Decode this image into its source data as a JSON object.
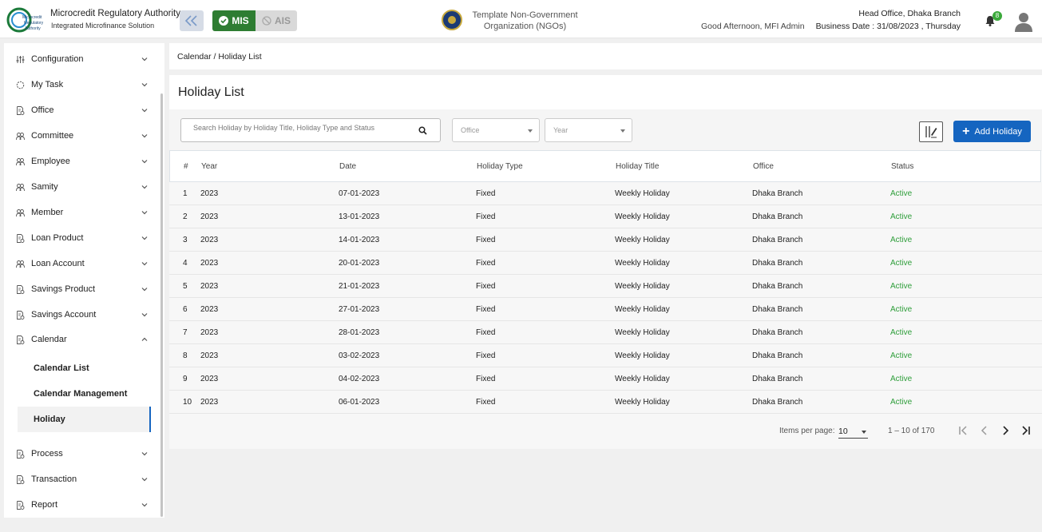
{
  "header": {
    "brand_title": "Microcredit Regulatory Authority",
    "brand_subtitle": "Integrated Microfinance Solution",
    "logo_text": "Microcredit Regulatory Authority",
    "mode_mis": "MIS",
    "mode_ais": "AIS",
    "org_name": "Template Non-Government Organization (NGOs)",
    "greeting": "Good Afternoon, MFI Admin",
    "head_office": "Head Office, Dhaka Branch",
    "business_date": "Business Date : 31/08/2023 , Thursday",
    "notification_count": "8",
    "colors": {
      "mis_active": "#2e7d32",
      "primary": "#1565c0",
      "status_active": "#2e9e3a"
    }
  },
  "sidebar": {
    "items": [
      {
        "label": "Configuration",
        "icon": "sliders-icon"
      },
      {
        "label": "My Task",
        "icon": "task-circle-icon"
      },
      {
        "label": "Office",
        "icon": "document-gear-icon"
      },
      {
        "label": "Committee",
        "icon": "committee-icon"
      },
      {
        "label": "Employee",
        "icon": "employee-icon"
      },
      {
        "label": "Samity",
        "icon": "samity-icon"
      },
      {
        "label": "Member",
        "icon": "member-icon"
      },
      {
        "label": "Loan Product",
        "icon": "document-gear-icon"
      },
      {
        "label": "Loan Account",
        "icon": "member-icon"
      },
      {
        "label": "Savings Product",
        "icon": "document-gear-icon"
      },
      {
        "label": "Savings Account",
        "icon": "document-gear-icon"
      },
      {
        "label": "Calendar",
        "icon": "document-gear-icon"
      },
      {
        "label": "Process",
        "icon": "document-gear-icon"
      },
      {
        "label": "Transaction",
        "icon": "document-gear-icon"
      },
      {
        "label": "Report",
        "icon": "document-gear-icon"
      }
    ],
    "calendar_sub": [
      {
        "label": "Calendar List"
      },
      {
        "label": "Calendar Management"
      },
      {
        "label": "Holiday"
      }
    ]
  },
  "breadcrumb": "Calendar / Holiday List",
  "page_title": "Holiday List",
  "toolbar": {
    "search_placeholder": "Search Holiday by Holiday Title, Holiday Type and Status",
    "office_placeholder": "Office",
    "year_placeholder": "Year",
    "add_label": "Add Holiday"
  },
  "table": {
    "columns": [
      "#",
      "Year",
      "Date",
      "Holiday Type",
      "Holiday Title",
      "Office",
      "Status"
    ],
    "rows": [
      [
        "1",
        "2023",
        "07-01-2023",
        "Fixed",
        "Weekly Holiday",
        "Dhaka Branch",
        "Active"
      ],
      [
        "2",
        "2023",
        "13-01-2023",
        "Fixed",
        "Weekly Holiday",
        "Dhaka Branch",
        "Active"
      ],
      [
        "3",
        "2023",
        "14-01-2023",
        "Fixed",
        "Weekly Holiday",
        "Dhaka Branch",
        "Active"
      ],
      [
        "4",
        "2023",
        "20-01-2023",
        "Fixed",
        "Weekly Holiday",
        "Dhaka Branch",
        "Active"
      ],
      [
        "5",
        "2023",
        "21-01-2023",
        "Fixed",
        "Weekly Holiday",
        "Dhaka Branch",
        "Active"
      ],
      [
        "6",
        "2023",
        "27-01-2023",
        "Fixed",
        "Weekly Holiday",
        "Dhaka Branch",
        "Active"
      ],
      [
        "7",
        "2023",
        "28-01-2023",
        "Fixed",
        "Weekly Holiday",
        "Dhaka Branch",
        "Active"
      ],
      [
        "8",
        "2023",
        "03-02-2023",
        "Fixed",
        "Weekly Holiday",
        "Dhaka Branch",
        "Active"
      ],
      [
        "9",
        "2023",
        "04-02-2023",
        "Fixed",
        "Weekly Holiday",
        "Dhaka Branch",
        "Active"
      ],
      [
        "10",
        "2023",
        "06-01-2023",
        "Fixed",
        "Weekly Holiday",
        "Dhaka Branch",
        "Active"
      ]
    ]
  },
  "paginator": {
    "items_per_page_label": "Items per page:",
    "items_per_page": "10",
    "range": "1 – 10 of 170"
  }
}
